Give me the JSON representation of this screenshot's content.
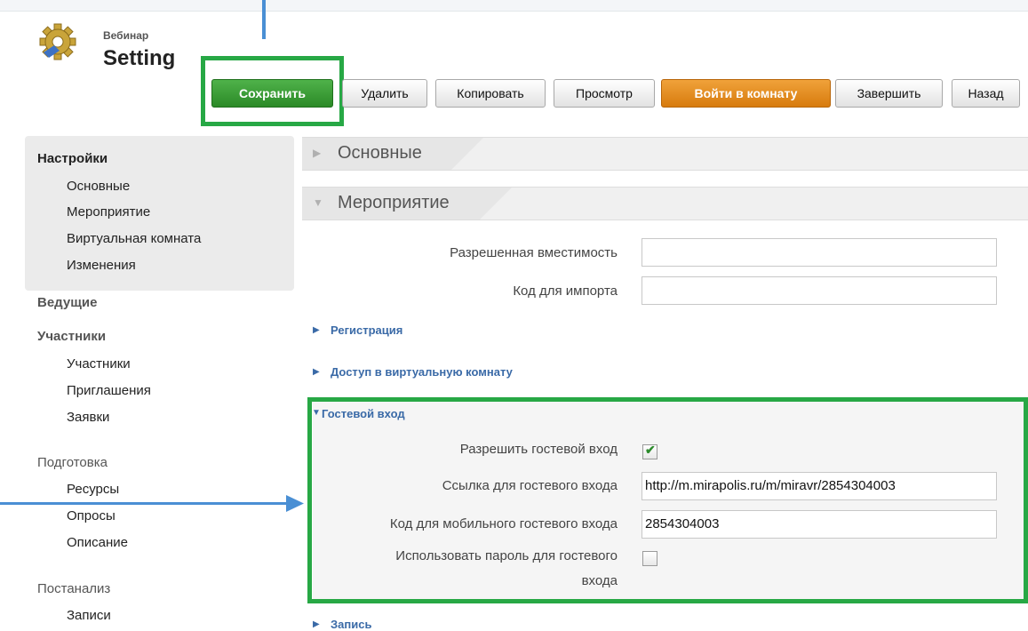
{
  "header": {
    "subtitle": "Вебинар",
    "title": "Setting"
  },
  "toolbar": {
    "save": "Сохранить",
    "delete": "Удалить",
    "copy": "Копировать",
    "view": "Просмотр",
    "enter_room": "Войти в комнату",
    "finish": "Завершить",
    "back": "Назад"
  },
  "sidebar": {
    "settings": {
      "title": "Настройки",
      "items": [
        "Основные",
        "Мероприятие",
        "Виртуальная комната",
        "Изменения"
      ]
    },
    "hosts": {
      "title": "Ведущие"
    },
    "participants": {
      "title": "Участники",
      "items": [
        "Участники",
        "Приглашения",
        "Заявки"
      ]
    },
    "preparation": {
      "title": "Подготовка",
      "items": [
        "Ресурсы",
        "Опросы",
        "Описание"
      ]
    },
    "postanalysis": {
      "title": "Постанализ",
      "items": [
        "Записи"
      ]
    }
  },
  "sections": {
    "basic": "Основные",
    "event": "Мероприятие"
  },
  "event_form": {
    "capacity_label": "Разрешенная вместимость",
    "capacity_value": "",
    "import_code_label": "Код для импорта",
    "import_code_value": ""
  },
  "subsections": {
    "registration": "Регистрация",
    "room_access": "Доступ в виртуальную комнату",
    "guest_login": "Гостевой вход",
    "recording": "Запись"
  },
  "guest": {
    "allow_label": "Разрешить гостевой вход",
    "allow_checked": true,
    "link_label": "Ссылка для гостевого входа",
    "link_value": "http://m.mirapolis.ru/m/miravr/2854304003",
    "mobile_code_label": "Код для мобильного гостевого входа",
    "mobile_code_value": "2854304003",
    "password_label_line1": "Использовать пароль для гостевого",
    "password_label_line2": "входа",
    "password_checked": false
  },
  "colors": {
    "highlight": "#27a845",
    "annotation_arrow": "#4a8fd4",
    "save_button": "#3a9e35",
    "enter_button": "#e08a1e",
    "link_blue": "#3a6aa7"
  },
  "icons": [
    "gear-icon",
    "triangle-right-icon",
    "triangle-down-icon",
    "checkmark-icon"
  ]
}
